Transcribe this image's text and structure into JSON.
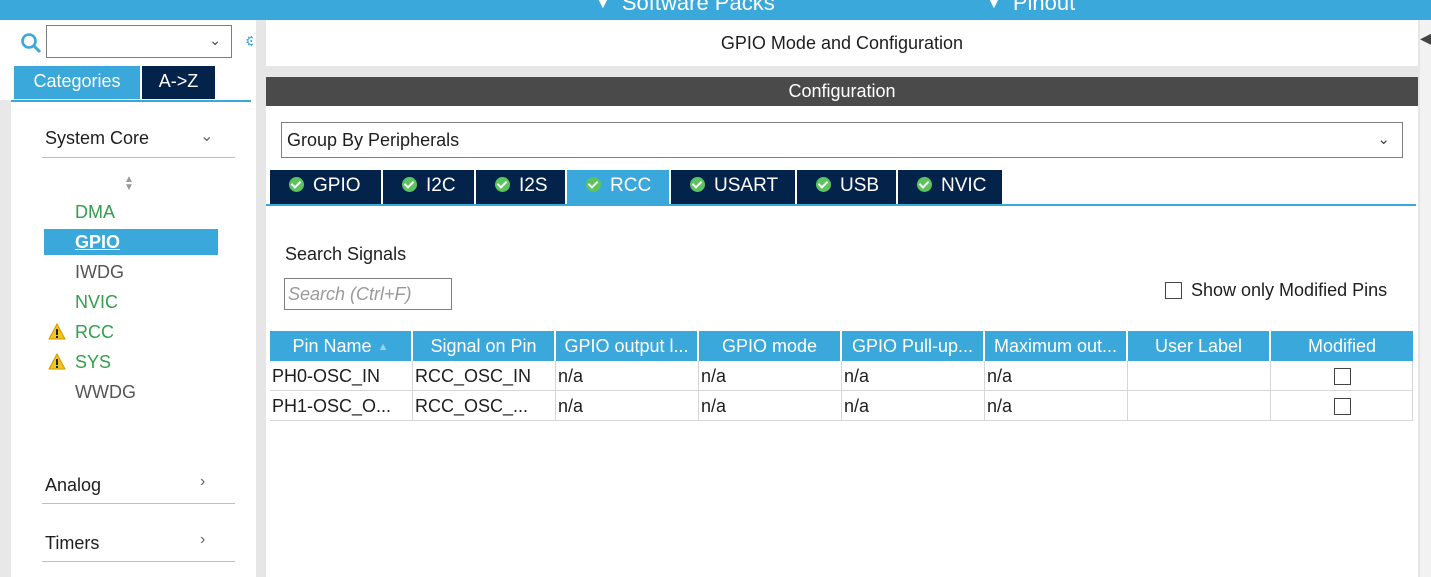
{
  "topbar": {
    "software_packs": "Software Packs",
    "pinout": "Pinout"
  },
  "sidebar": {
    "search_value": "",
    "tabs": [
      "Categories",
      "A->Z"
    ],
    "sections": [
      {
        "label": "System Core",
        "expanded": true
      },
      {
        "label": "Analog",
        "expanded": false
      },
      {
        "label": "Timers",
        "expanded": false
      }
    ],
    "items": [
      {
        "label": "DMA",
        "status": "ok"
      },
      {
        "label": "GPIO",
        "status": "ok",
        "selected": true
      },
      {
        "label": "IWDG",
        "status": "none"
      },
      {
        "label": "NVIC",
        "status": "ok"
      },
      {
        "label": "RCC",
        "status": "warning"
      },
      {
        "label": "SYS",
        "status": "warning"
      },
      {
        "label": "WWDG",
        "status": "none"
      }
    ]
  },
  "main": {
    "mode_title": "GPIO Mode and Configuration",
    "config_title": "Configuration",
    "group_by": "Group By Peripherals",
    "peripheral_tabs": [
      "GPIO",
      "I2C",
      "I2S",
      "RCC",
      "USART",
      "USB",
      "NVIC"
    ],
    "active_tab": "RCC",
    "search_label": "Search Signals",
    "search_placeholder": "Search (Ctrl+F)",
    "show_modified_label": "Show only Modified Pins",
    "table": {
      "columns": [
        "Pin Name",
        "Signal on Pin",
        "GPIO output l...",
        "GPIO mode",
        "GPIO Pull-up...",
        "Maximum out...",
        "User Label",
        "Modified"
      ],
      "rows": [
        [
          "PH0-OSC_IN",
          "RCC_OSC_IN",
          "n/a",
          "n/a",
          "n/a",
          "n/a",
          "",
          ""
        ],
        [
          "PH1-OSC_O...",
          "RCC_OSC_...",
          "n/a",
          "n/a",
          "n/a",
          "n/a",
          "",
          ""
        ]
      ]
    }
  },
  "colors": {
    "accent": "#3aa8db",
    "navy": "#03234b",
    "ok_green": "#30a04b",
    "warning": "#f5c518",
    "config_header": "#4a4a4a"
  }
}
